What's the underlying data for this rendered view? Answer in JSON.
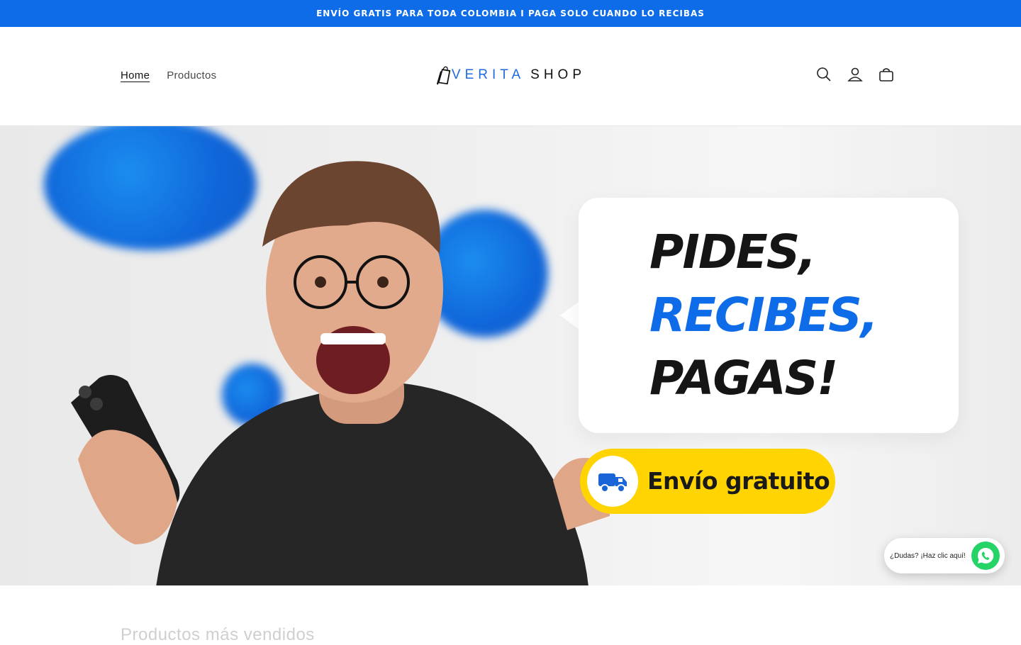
{
  "announcement": {
    "text": "ENVÍO GRATIS PARA TODA COLOMBIA I PAGA SOLO CUANDO LO RECIBAS"
  },
  "header": {
    "nav": [
      {
        "label": "Home",
        "active": true
      },
      {
        "label": "Productos",
        "active": false
      }
    ],
    "logo": {
      "word1": "VERITA",
      "word2": "SHOP"
    },
    "icons": [
      "search-icon",
      "account-icon",
      "cart-icon"
    ]
  },
  "hero": {
    "line1": "PIDES,",
    "line2": "RECIBES,",
    "line3": "PAGAS!",
    "badge_text": "Envío gratuito",
    "badge_icon": "truck-icon",
    "colors": {
      "accent": "#0f6ce8",
      "badge": "#ffd400"
    }
  },
  "whatsapp": {
    "text": "¿Dudas? ¡Haz clic aquí!",
    "icon": "whatsapp-icon",
    "color": "#25d366"
  },
  "section": {
    "title": "Productos más vendidos"
  }
}
